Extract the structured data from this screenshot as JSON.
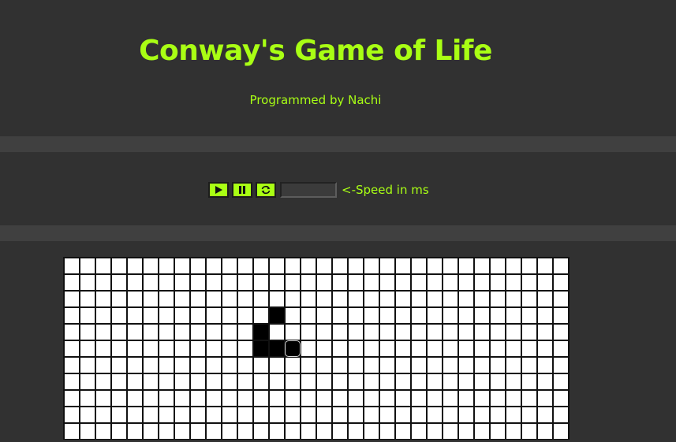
{
  "header": {
    "title": "Conway's Game of Life",
    "subtitle": "Programmed by Nachi"
  },
  "controls": {
    "play_icon": "play-icon",
    "pause_icon": "pause-icon",
    "reset_icon": "refresh-icon",
    "speed_value": "",
    "speed_label": "<-Speed in ms"
  },
  "colors": {
    "accent": "#a9ff14",
    "background": "#313131",
    "band": "#404040",
    "cell_dead": "#ffffff",
    "cell_alive": "#000000"
  },
  "board": {
    "columns": 32,
    "visible_rows": 11,
    "alive_cells": [
      [
        3,
        13
      ],
      [
        4,
        12
      ],
      [
        5,
        12
      ],
      [
        5,
        13
      ],
      [
        5,
        14
      ]
    ],
    "focused_cell": [
      5,
      14
    ]
  }
}
